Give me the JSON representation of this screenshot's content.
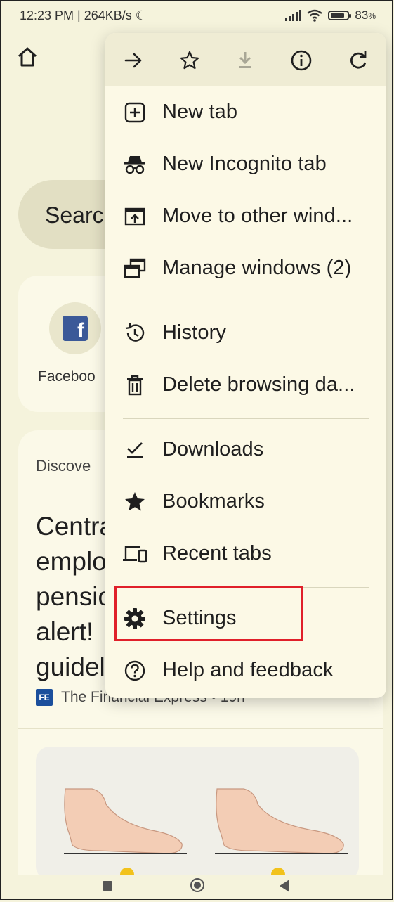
{
  "status_bar": {
    "time_speed": "12:23 PM | 264KB/s",
    "moon_icon": "☾",
    "battery": "83",
    "battery_unit": "%"
  },
  "page": {
    "search_text": "Searc",
    "shortcut_label": "Faceboo",
    "fb_letter": "f",
    "discover_label": "Discove",
    "headline_lines": [
      "Centra",
      "emplo",
      "pensio",
      "alert!",
      "guidel"
    ],
    "source_badge": "FE",
    "source_text": "The Financial Express • 19h"
  },
  "menu": {
    "toolbar": [
      "forward-icon",
      "bookmark-star-icon",
      "download-icon",
      "info-icon",
      "reload-icon"
    ],
    "items": [
      {
        "label": "New tab",
        "icon": "new-tab-icon"
      },
      {
        "label": "New Incognito tab",
        "icon": "incognito-icon"
      },
      {
        "label": "Move to other wind...",
        "icon": "move-window-icon"
      },
      {
        "label": "Manage windows (2)",
        "icon": "manage-windows-icon"
      },
      {
        "label": "History",
        "icon": "history-icon"
      },
      {
        "label": "Delete browsing da...",
        "icon": "trash-icon"
      },
      {
        "label": "Downloads",
        "icon": "downloads-icon"
      },
      {
        "label": "Bookmarks",
        "icon": "bookmarks-star-icon"
      },
      {
        "label": "Recent tabs",
        "icon": "recent-tabs-icon"
      },
      {
        "label": "Settings",
        "icon": "gear-icon"
      },
      {
        "label": "Help and feedback",
        "icon": "help-icon"
      }
    ]
  },
  "colors": {
    "background": "#f5f3dc",
    "menu_background": "#fcf9e6",
    "highlight_border": "#e0202a"
  }
}
